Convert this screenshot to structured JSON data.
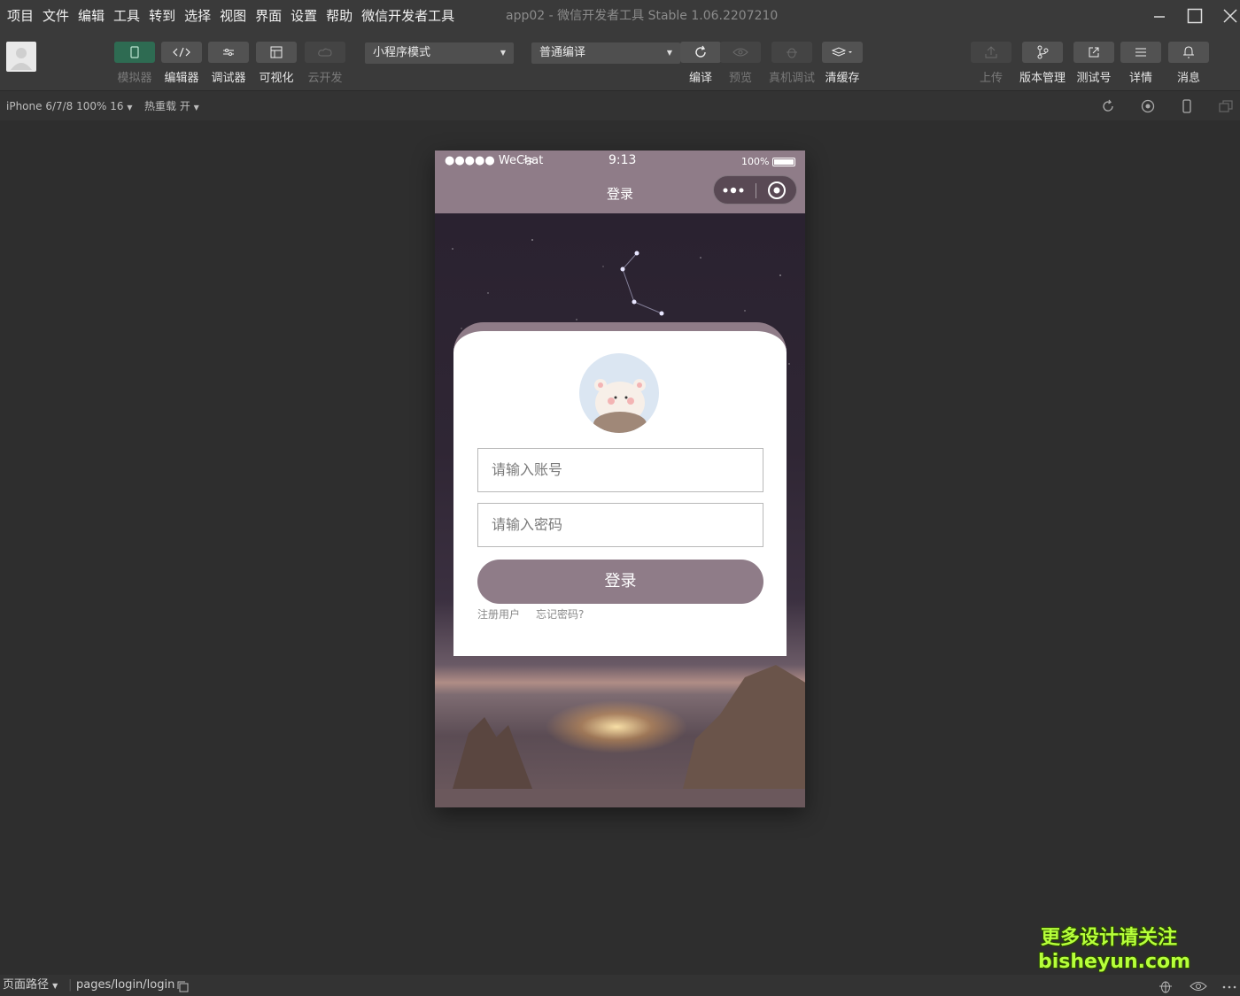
{
  "menu": [
    "项目",
    "文件",
    "编辑",
    "工具",
    "转到",
    "选择",
    "视图",
    "界面",
    "设置",
    "帮助",
    "微信开发者工具"
  ],
  "window_title": "app02 - 微信开发者工具 Stable 1.06.2207210",
  "toolbar": {
    "simulator": "模拟器",
    "editor": "编辑器",
    "debugger": "调试器",
    "visual": "可视化",
    "cloud": "云开发",
    "mode_select": "小程序模式",
    "compile_select": "普通编译",
    "compile": "编译",
    "preview": "预览",
    "real_debug": "真机调试",
    "clear_cache": "清缓存",
    "upload": "上传",
    "version": "版本管理",
    "test_id": "测试号",
    "details": "详情",
    "messages": "消息"
  },
  "subbar": {
    "device": "iPhone 6/7/8 100% 16",
    "hot_reload": "热重载 开"
  },
  "phone": {
    "carrier": "●●●●● WeChat",
    "time": "9:13",
    "battery": "100%",
    "nav_title": "登录",
    "account_placeholder": "请输入账号",
    "password_placeholder": "请输入密码",
    "login_button": "登录",
    "register_link": "注册用户",
    "forgot_link": "忘记密码?"
  },
  "bottombar": {
    "page_path_label": "页面路径",
    "page_path": "pages/login/login"
  },
  "watermark": {
    "line1": "更多设计请关注",
    "line2": "bisheyun.com"
  },
  "colors": {
    "theme": "#8f7c88",
    "active_simulator": "#2e6b52",
    "watermark": "#b6ff3a"
  }
}
